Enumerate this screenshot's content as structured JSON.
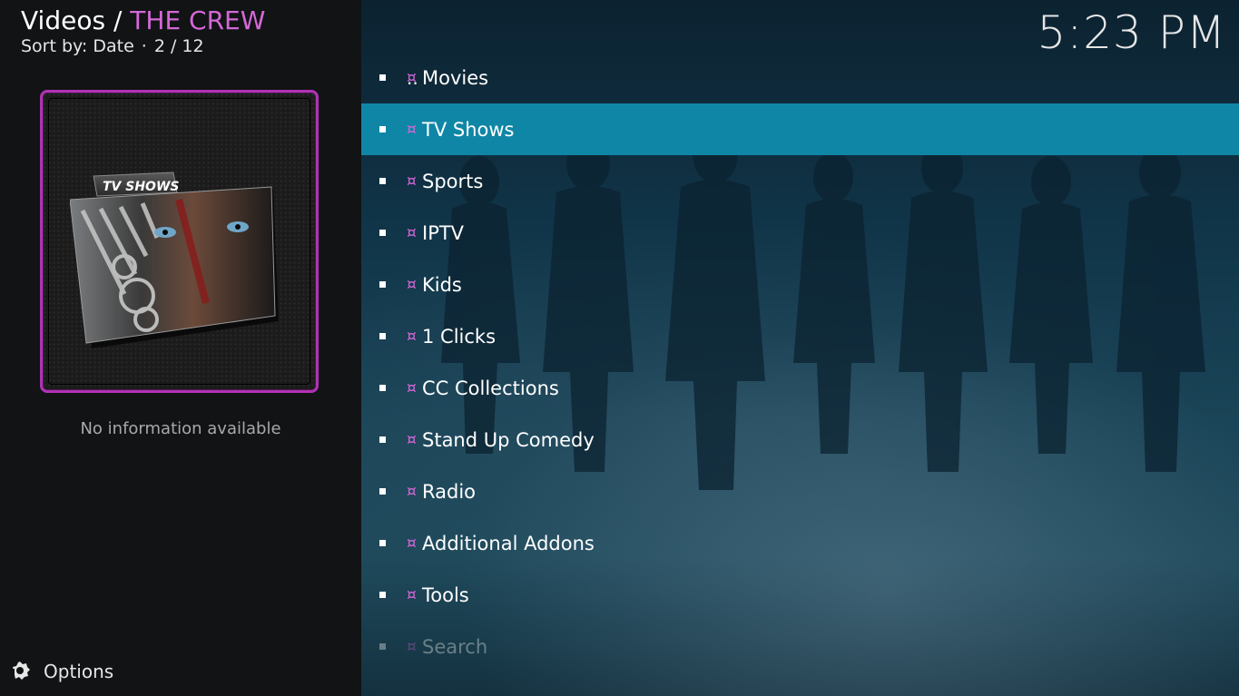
{
  "header": {
    "section": "Videos",
    "separator": " / ",
    "addon": "THE CREW",
    "sort_label": "Sort by: Date",
    "sort_dot": "·",
    "position": "2 / 12"
  },
  "clock": "5:23 PM",
  "thumbnail": {
    "badge": "TV SHOWS",
    "icon": "tv-shows-folder-icon",
    "frame_color": "#b032b4"
  },
  "info_text": "No information available",
  "options_label": "Options",
  "parent_item": "..",
  "marker": "¤",
  "items": [
    {
      "label": "Movies"
    },
    {
      "label": "TV Shows"
    },
    {
      "label": "Sports"
    },
    {
      "label": "IPTV"
    },
    {
      "label": "Kids"
    },
    {
      "label": "1 Clicks"
    },
    {
      "label": "CC Collections"
    },
    {
      "label": "Stand Up Comedy"
    },
    {
      "label": "Radio"
    },
    {
      "label": "Additional Addons"
    },
    {
      "label": "Tools"
    },
    {
      "label": "Search"
    }
  ],
  "selected_index": 1,
  "colors": {
    "accent": "#d468d6",
    "selection": "#0f86a6"
  }
}
